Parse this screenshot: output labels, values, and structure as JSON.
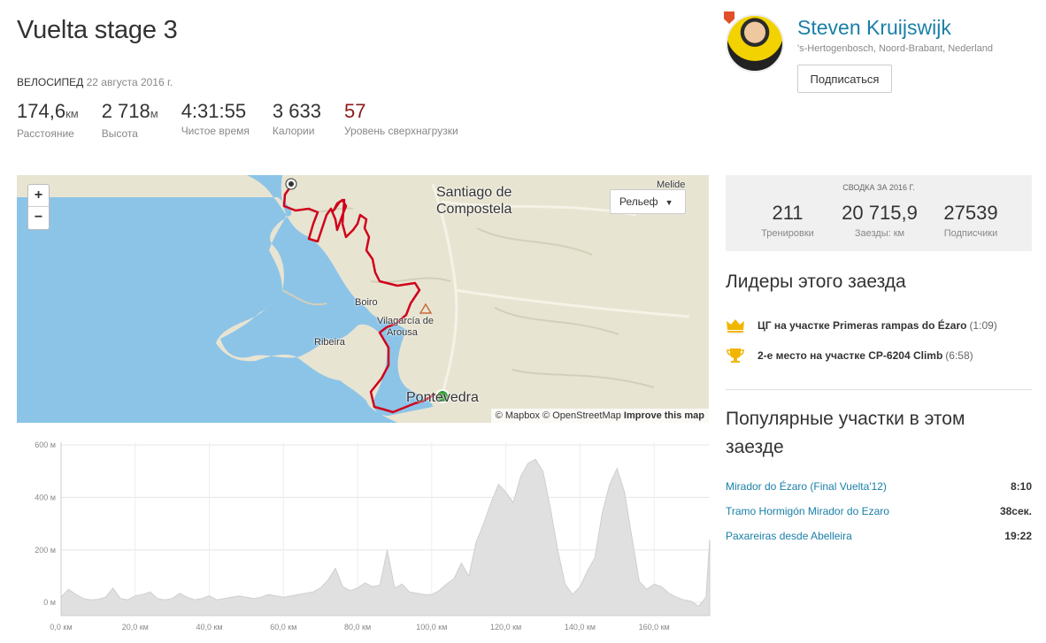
{
  "activity": {
    "title": "Vuelta stage 3",
    "type": "ВЕЛОСИПЕД",
    "date": "22 августа 2016 г."
  },
  "stats": [
    {
      "value": "174,6",
      "unit": "км",
      "label": "Расстояние"
    },
    {
      "value": "2 718",
      "unit": "м",
      "label": "Высота"
    },
    {
      "value": "4:31:55",
      "unit": "",
      "label": "Чистое время"
    },
    {
      "value": "3 633",
      "unit": "",
      "label": "Калории"
    },
    {
      "value": "57",
      "unit": "",
      "label": "Уровень сверхнагрузки"
    }
  ],
  "athlete": {
    "name": "Steven Kruijswijk",
    "location": "'s-Hertogenbosch, Noord-Brabant, Nederland",
    "follow_label": "Подписаться"
  },
  "map": {
    "zoom_in": "+",
    "zoom_out": "−",
    "layer_label": "Рельеф",
    "attribution_mapbox": "© Mapbox",
    "attribution_osm": "© OpenStreetMap",
    "attribution_improve": "Improve this map",
    "labels": {
      "santiago": "Santiago de",
      "compostela": "Compostela",
      "melide": "Melide",
      "boiro": "Boiro",
      "vilagarcia1": "Vilagarcía de",
      "vilagarcia2": "Arousa",
      "ribeira": "Ribeira",
      "pontevedra": "Pontevedra"
    }
  },
  "summary": {
    "caption": "СВОДКА ЗА 2016 Г.",
    "items": [
      {
        "value": "211",
        "label": "Тренировки"
      },
      {
        "value": "20 715,9",
        "label": "Заезды: км"
      },
      {
        "value": "27539",
        "label": "Подписчики"
      }
    ]
  },
  "leaders": {
    "title": "Лидеры этого заезда",
    "items": [
      {
        "text": "ЦГ на участке Primeras rampas do Ézaro",
        "time": "(1:09)"
      },
      {
        "text": "2-е место на участке CP-6204 Climb",
        "time": "(6:58)"
      }
    ]
  },
  "popular": {
    "title_line1": "Популярные участки в этом",
    "title_line2": "заезде",
    "segments": [
      {
        "name": "Mirador do Ézaro (Final Vuelta'12)",
        "time": "8:10"
      },
      {
        "name": "Tramo Hormigón Mirador do Ezaro",
        "time": "38сек."
      },
      {
        "name": "Paxareiras desde Abelleira",
        "time": "19:22"
      }
    ]
  },
  "chart_data": {
    "type": "area",
    "title": "",
    "xlabel": "",
    "ylabel": "",
    "x_ticks": [
      "0,0 км",
      "20,0 км",
      "40,0 км",
      "60,0 км",
      "80,0 км",
      "100,0 км",
      "120,0 км",
      "140,0 км",
      "160,0 км"
    ],
    "y_ticks": [
      "0 м",
      "200 м",
      "400 м",
      "600 м"
    ],
    "xlim": [
      0,
      175
    ],
    "ylim": [
      -50,
      610
    ],
    "grid": true,
    "color": "#e0e0e0",
    "x": [
      0,
      2,
      4,
      6,
      8,
      10,
      12,
      14,
      16,
      18,
      20,
      22,
      24,
      26,
      28,
      30,
      32,
      34,
      36,
      38,
      40,
      42,
      44,
      46,
      48,
      50,
      52,
      54,
      56,
      58,
      60,
      62,
      64,
      66,
      68,
      70,
      72,
      74,
      76,
      78,
      80,
      82,
      84,
      86,
      88,
      90,
      92,
      94,
      96,
      98,
      100,
      102,
      104,
      106,
      108,
      110,
      112,
      114,
      116,
      118,
      120,
      122,
      124,
      126,
      128,
      130,
      132,
      134,
      136,
      138,
      140,
      142,
      144,
      146,
      148,
      150,
      152,
      154,
      156,
      158,
      160,
      162,
      164,
      166,
      168,
      170,
      172,
      174,
      175
    ],
    "y": [
      20,
      50,
      30,
      15,
      10,
      12,
      20,
      55,
      15,
      10,
      25,
      30,
      40,
      15,
      10,
      15,
      35,
      20,
      10,
      15,
      25,
      10,
      15,
      20,
      25,
      20,
      15,
      20,
      30,
      25,
      20,
      25,
      30,
      35,
      40,
      55,
      85,
      130,
      60,
      45,
      55,
      75,
      60,
      65,
      200,
      55,
      70,
      40,
      35,
      30,
      30,
      45,
      70,
      90,
      150,
      100,
      230,
      300,
      380,
      450,
      420,
      380,
      480,
      530,
      545,
      500,
      360,
      200,
      70,
      30,
      60,
      120,
      170,
      340,
      450,
      510,
      420,
      250,
      80,
      50,
      70,
      60,
      35,
      20,
      10,
      5,
      -15,
      20,
      240
    ]
  }
}
